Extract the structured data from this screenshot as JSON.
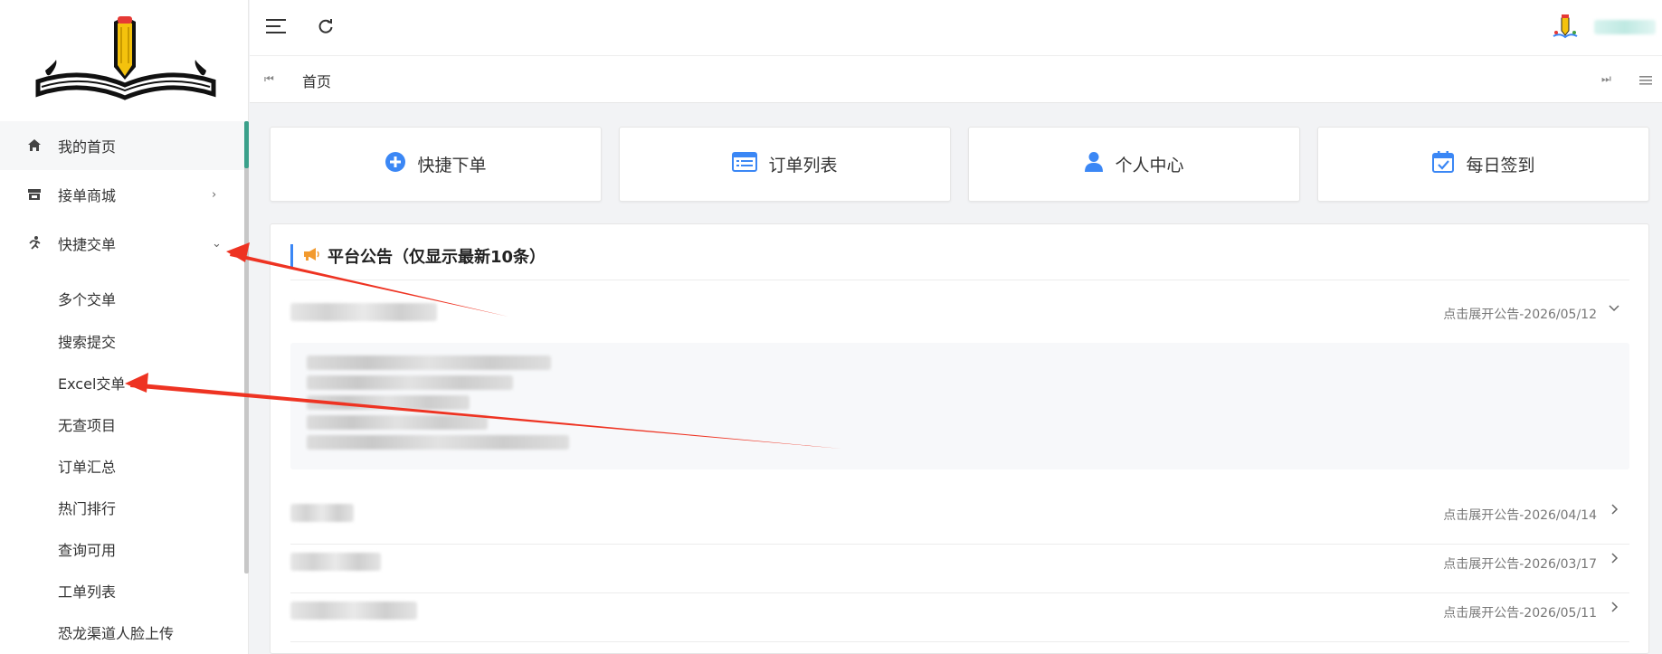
{
  "sidebar": {
    "items": [
      {
        "label": "我的首页",
        "icon": "home-icon"
      },
      {
        "label": "接单商城",
        "icon": "store-icon",
        "chevron": "›"
      },
      {
        "label": "快捷交单",
        "icon": "runner-icon",
        "chevron": "⌄"
      }
    ],
    "sub_items": [
      "多个交单",
      "搜索提交",
      "Excel交单",
      "无查项目",
      "订单汇总",
      "热门排行",
      "查询可用",
      "工单列表",
      "恐龙渠道人脸上传"
    ]
  },
  "header": {
    "menu_icon": "hamburger-icon",
    "refresh_icon": "refresh-icon",
    "avatar_icon": "avatar-icon"
  },
  "tabs": {
    "items": [
      {
        "label": "首页"
      }
    ],
    "prev_icon": "skip-back-icon",
    "next_icon": "skip-forward-icon",
    "menu_icon": "list-menu-icon"
  },
  "quick_links": [
    {
      "label": "快捷下单",
      "icon": "plus-circle-icon"
    },
    {
      "label": "订单列表",
      "icon": "list-card-icon"
    },
    {
      "label": "个人中心",
      "icon": "user-icon"
    },
    {
      "label": "每日签到",
      "icon": "calendar-check-icon"
    }
  ],
  "notices": {
    "title": "平台公告（仅显示最新10条）",
    "items": [
      {
        "date": "点击展开公告-2026/05/12",
        "expanded": true
      },
      {
        "date": "点击展开公告-2026/04/14",
        "expanded": false
      },
      {
        "date": "点击展开公告-2026/03/17",
        "expanded": false
      },
      {
        "date": "点击展开公告-2026/05/11",
        "expanded": false
      }
    ]
  },
  "colors": {
    "accent": "#3b87f5",
    "sidebar_active": "#3aa08a",
    "annotation_arrow": "#ee3322",
    "megaphone": "#f29a2e"
  }
}
